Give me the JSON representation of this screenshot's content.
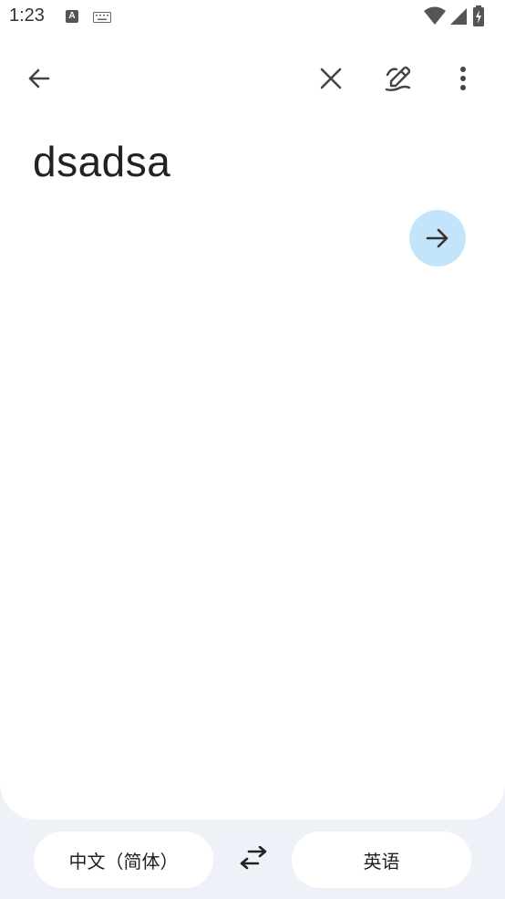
{
  "status_bar": {
    "time": "1:23",
    "a_badge": "A",
    "icons": [
      "a-notification-icon",
      "keyboard-icon",
      "wifi-icon",
      "signal-icon",
      "battery-charging-icon"
    ]
  },
  "toolbar": {
    "icons": [
      "arrow-back-icon",
      "close-icon",
      "handwriting-icon",
      "more-vert-icon"
    ]
  },
  "input": {
    "text": "dsadsa"
  },
  "languages": {
    "source": "中文（简体）",
    "target": "英语"
  },
  "colors": {
    "go_button_bg": "#c4e4fb",
    "page_bg": "#eef1f8",
    "panel_bg": "#ffffff"
  }
}
